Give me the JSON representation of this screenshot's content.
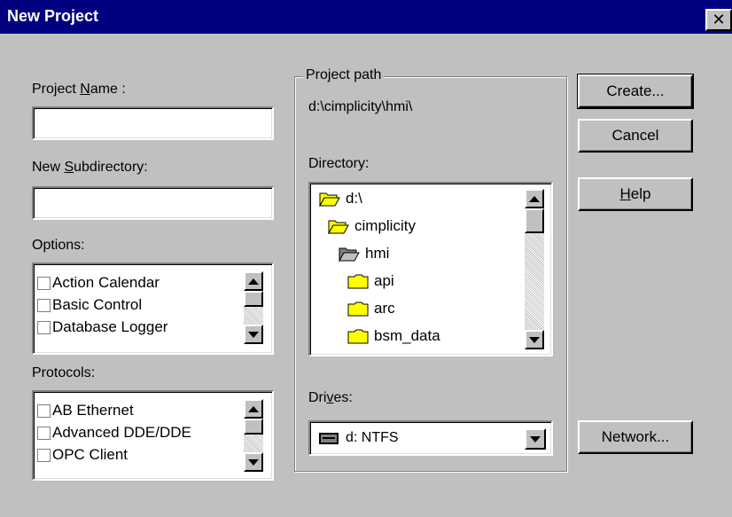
{
  "window": {
    "title": "New Project",
    "close_glyph": "✕"
  },
  "project_name": {
    "label_pre": "Project ",
    "label_accel": "N",
    "label_post": "ame :",
    "value": ""
  },
  "subdirectory": {
    "label_pre": "New ",
    "label_accel": "S",
    "label_post": "ubdirectory:",
    "value": ""
  },
  "options": {
    "label": "Options:",
    "items": [
      "Action Calendar",
      "Basic Control",
      "Database Logger"
    ]
  },
  "protocols": {
    "label": "Protocols:",
    "items": [
      "AB Ethernet",
      "Advanced DDE/DDE",
      "OPC Client"
    ]
  },
  "project_path": {
    "label": "Project path",
    "value": "d:\\cimplicity\\hmi\\"
  },
  "directory": {
    "label": "Directory:",
    "items": [
      {
        "name": "d:\\",
        "icon": "open-folder-icon"
      },
      {
        "name": "cimplicity",
        "icon": "open-folder-icon"
      },
      {
        "name": "hmi",
        "icon": "open-folder-icon"
      },
      {
        "name": "api",
        "icon": "folder-icon"
      },
      {
        "name": "arc",
        "icon": "folder-icon"
      },
      {
        "name": "bsm_data",
        "icon": "folder-icon"
      }
    ]
  },
  "drives": {
    "label_pre": "Dri",
    "label_accel": "v",
    "label_post": "es:",
    "selected": "d: NTFS",
    "icon": "drive-icon"
  },
  "buttons": {
    "create": "Create...",
    "cancel": "Cancel",
    "help_accel": "H",
    "help_rest": "elp",
    "network": "Network..."
  },
  "colors": {
    "titlebar": "#000080",
    "dialog": "#c0c0c0",
    "folder": "#ffff00"
  }
}
